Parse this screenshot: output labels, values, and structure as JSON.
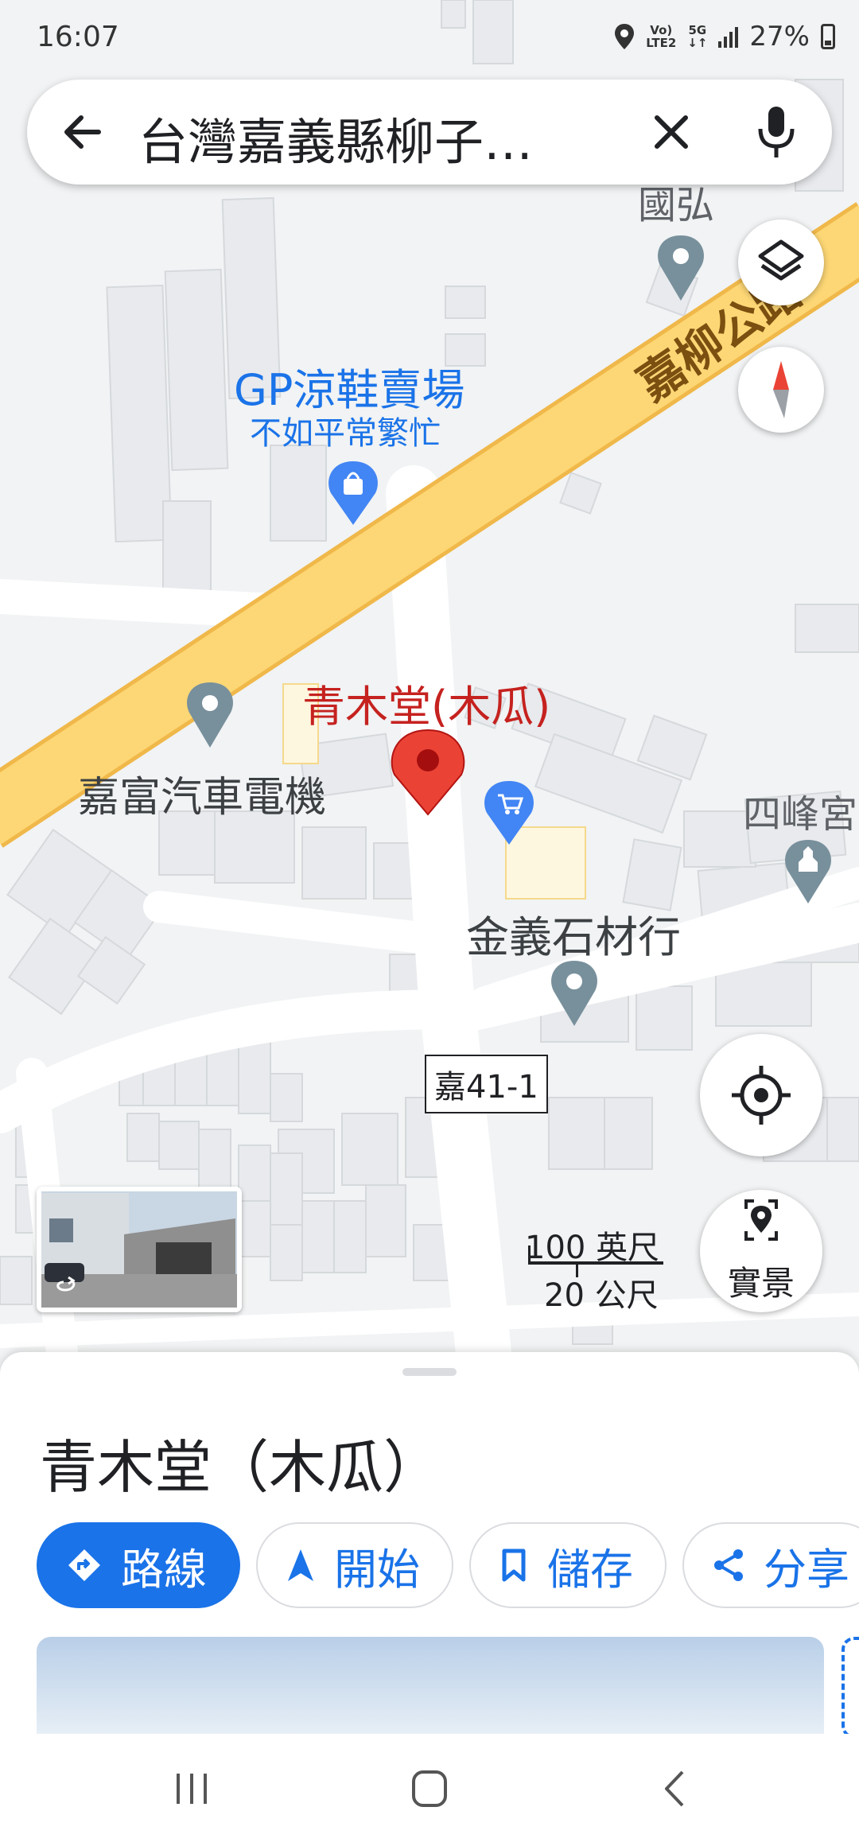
{
  "status_bar": {
    "time": "16:07",
    "network_top": "Vo)",
    "network_bottom": "LTE2",
    "network_type": "5G",
    "battery": "27%",
    "icons": [
      "location-icon",
      "signal-icon",
      "battery-icon"
    ]
  },
  "search": {
    "query": "台灣嘉義縣柳子…",
    "icons": [
      "back-arrow-icon",
      "close-icon",
      "microphone-icon"
    ]
  },
  "map": {
    "road_name": "嘉柳公路",
    "road_number": "嘉41-1",
    "labels": {
      "guohong": "國弘",
      "gp_name": "GP涼鞋賣場",
      "gp_subtitle": "不如平常繁忙",
      "selected_place": "青木堂(木瓜)",
      "jiafu": "嘉富汽車電機",
      "sifeng": "四峰宮",
      "jinyi": "金義石材行"
    },
    "colors": {
      "road_major": "#fdd775",
      "road_major_edge": "#f0b84a",
      "selected_pin": "#ea4335",
      "poi_gray": "#78909c",
      "poi_blue": "#4285f4",
      "selected_label": "#c5221f",
      "blue_label": "#1a73e8"
    }
  },
  "controls": {
    "street_view_label": "實景",
    "icons": [
      "layers-icon",
      "compass-icon",
      "my-location-icon",
      "street-view-icon",
      "rotate-360-icon"
    ]
  },
  "scale": {
    "imperial": "100 英尺",
    "metric": "20 公尺"
  },
  "sheet": {
    "title": "青木堂（木瓜）",
    "actions": [
      {
        "label": "路線",
        "icon": "directions-icon"
      },
      {
        "label": "開始",
        "icon": "navigation-arrow-icon"
      },
      {
        "label": "儲存",
        "icon": "bookmark-icon"
      },
      {
        "label": "分享",
        "icon": "share-icon"
      }
    ]
  },
  "nav_bar": {
    "icons": [
      "recents-icon",
      "home-icon",
      "back-icon"
    ]
  }
}
